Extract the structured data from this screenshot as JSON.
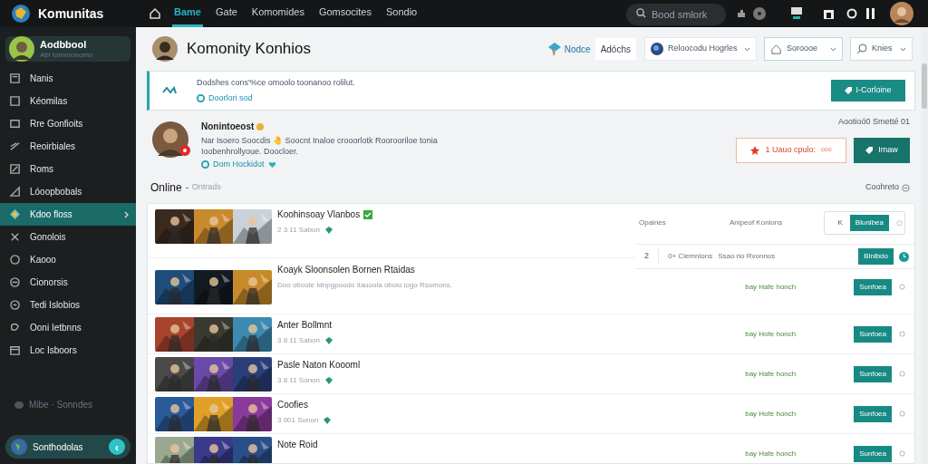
{
  "app": {
    "name": "Komunitas"
  },
  "topnav": [
    {
      "label": "Bame",
      "selected": true
    },
    {
      "label": "Gate",
      "selected": false
    },
    {
      "label": "Komomides",
      "selected": false
    },
    {
      "label": "Gomsocites",
      "selected": false
    },
    {
      "label": "Sondio",
      "selected": false
    }
  ],
  "search": {
    "placeholder": "Bood smlork"
  },
  "user_card": {
    "name": "Aodbbool",
    "subtitle": "Abl tommonomo"
  },
  "sidebar": {
    "items": [
      {
        "label": "Nanis",
        "selected": false
      },
      {
        "label": "Kéomilas",
        "selected": false
      },
      {
        "label": "Rre Gonfioits",
        "selected": false
      },
      {
        "label": "Reoirbiales",
        "selected": false
      },
      {
        "label": "Roms",
        "selected": false
      },
      {
        "label": "Lóoopbobals",
        "selected": false
      },
      {
        "label": "Kdoo floss",
        "selected": true
      },
      {
        "label": "Gonolois",
        "selected": false
      },
      {
        "label": "Kaooo",
        "selected": false
      },
      {
        "label": "Cionorsis",
        "selected": false
      },
      {
        "label": "Tedi Islobios",
        "selected": false
      },
      {
        "label": "Ooni Ietbnns",
        "selected": false
      },
      {
        "label": "Loc Isboors",
        "selected": false
      }
    ],
    "footer_label": "Mibe · Sonndes",
    "bottom_pill": "Sonthodolas",
    "bottom_button": "‹"
  },
  "header": {
    "title": "Komonity Konhios",
    "brand_label": "Nodce",
    "button": "Adóchs",
    "dropdowns": [
      "Reloocodu Hogrles",
      "Soroooe",
      "Knies"
    ]
  },
  "banner": {
    "text": "Dodshes cons'%ce omoolo toonanoo rolilut.",
    "link": "Doorlori sod",
    "button": "I-Corloine"
  },
  "profile": {
    "name": "Nonintoeost",
    "text": "Nar Isoero Soocdis 🤚 Soocnt Inaloe crooorlotk Roorooriloe tonia Ioobenhrollyoue. Doocloer.",
    "link": "Dom Hockidot",
    "meta": "Aootioó0 Smetté 01",
    "report_button": "1 Uauo cpulo:",
    "report_suffix": "ooo",
    "primary_button": "Imaw"
  },
  "section": {
    "title": "Online",
    "subtitle": "Ontrads",
    "right_label": "Coohreto"
  },
  "rows": [
    {
      "kind": "featured",
      "title": "Koohinsoay Vlanbos",
      "verified": true,
      "subtitle": "2 3 11 Sabon",
      "col_a": "Opaines",
      "col_b": "Anipeof Konions",
      "box_letter": "K",
      "button": "Blunlbea",
      "popup": {
        "number": "2",
        "col_a": "0+ Clemnlons",
        "col_b": "Ssao rio Rvonnos",
        "button": "Blnlbdo"
      }
    },
    {
      "kind": "standard",
      "title": "Koayk Sloonsolen Bornen Rtaidas",
      "description": "Doo oboole Idnpgpoodo Ilauoola oboio iogo Rsomons.",
      "status": "bay Hafe honch",
      "button": "Sunfoea"
    },
    {
      "kind": "standard",
      "title": "Anter Bollmnt",
      "subtitle": "3 8 11 Sabon",
      "status": "bay Hofe honch",
      "button": "Sunfoea"
    },
    {
      "kind": "standard",
      "title": "Pasle Naton Koooml",
      "subtitle": "3 8 11 Sonon",
      "status": "bay Hafe honch",
      "button": "Sunfoea"
    },
    {
      "kind": "standard",
      "title": "Coofies",
      "subtitle": "3 001 Sonon",
      "status": "bay Hofe honch",
      "button": "Sunfoea"
    },
    {
      "kind": "standard",
      "title": "Note Roid",
      "status": "bay Hafe honch",
      "button": "Sunfoea"
    }
  ]
}
